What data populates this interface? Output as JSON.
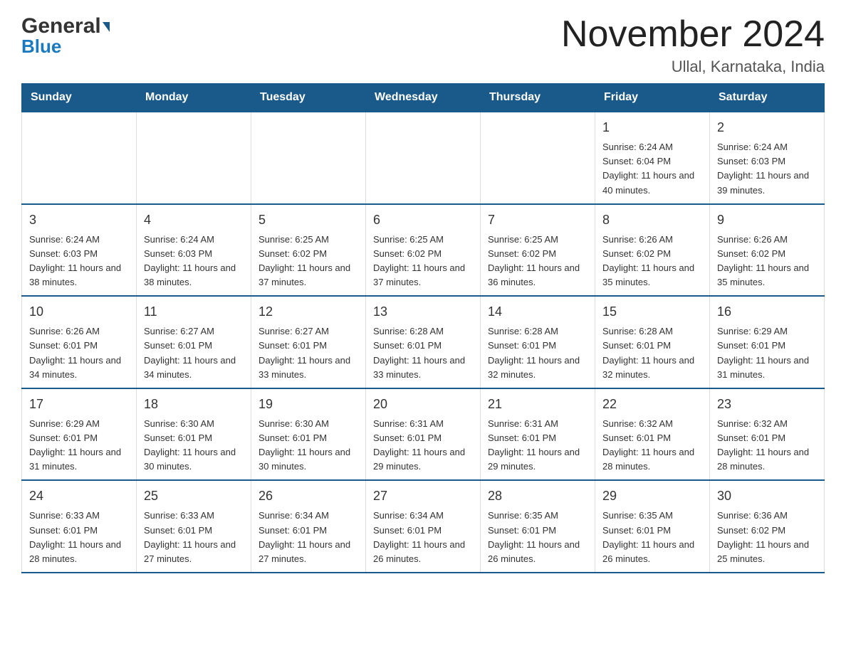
{
  "header": {
    "logo_main": "General",
    "logo_blue": "Blue",
    "month_title": "November 2024",
    "location": "Ullal, Karnataka, India"
  },
  "days_of_week": [
    "Sunday",
    "Monday",
    "Tuesday",
    "Wednesday",
    "Thursday",
    "Friday",
    "Saturday"
  ],
  "weeks": [
    [
      {
        "day": "",
        "info": ""
      },
      {
        "day": "",
        "info": ""
      },
      {
        "day": "",
        "info": ""
      },
      {
        "day": "",
        "info": ""
      },
      {
        "day": "",
        "info": ""
      },
      {
        "day": "1",
        "info": "Sunrise: 6:24 AM\nSunset: 6:04 PM\nDaylight: 11 hours and 40 minutes."
      },
      {
        "day": "2",
        "info": "Sunrise: 6:24 AM\nSunset: 6:03 PM\nDaylight: 11 hours and 39 minutes."
      }
    ],
    [
      {
        "day": "3",
        "info": "Sunrise: 6:24 AM\nSunset: 6:03 PM\nDaylight: 11 hours and 38 minutes."
      },
      {
        "day": "4",
        "info": "Sunrise: 6:24 AM\nSunset: 6:03 PM\nDaylight: 11 hours and 38 minutes."
      },
      {
        "day": "5",
        "info": "Sunrise: 6:25 AM\nSunset: 6:02 PM\nDaylight: 11 hours and 37 minutes."
      },
      {
        "day": "6",
        "info": "Sunrise: 6:25 AM\nSunset: 6:02 PM\nDaylight: 11 hours and 37 minutes."
      },
      {
        "day": "7",
        "info": "Sunrise: 6:25 AM\nSunset: 6:02 PM\nDaylight: 11 hours and 36 minutes."
      },
      {
        "day": "8",
        "info": "Sunrise: 6:26 AM\nSunset: 6:02 PM\nDaylight: 11 hours and 35 minutes."
      },
      {
        "day": "9",
        "info": "Sunrise: 6:26 AM\nSunset: 6:02 PM\nDaylight: 11 hours and 35 minutes."
      }
    ],
    [
      {
        "day": "10",
        "info": "Sunrise: 6:26 AM\nSunset: 6:01 PM\nDaylight: 11 hours and 34 minutes."
      },
      {
        "day": "11",
        "info": "Sunrise: 6:27 AM\nSunset: 6:01 PM\nDaylight: 11 hours and 34 minutes."
      },
      {
        "day": "12",
        "info": "Sunrise: 6:27 AM\nSunset: 6:01 PM\nDaylight: 11 hours and 33 minutes."
      },
      {
        "day": "13",
        "info": "Sunrise: 6:28 AM\nSunset: 6:01 PM\nDaylight: 11 hours and 33 minutes."
      },
      {
        "day": "14",
        "info": "Sunrise: 6:28 AM\nSunset: 6:01 PM\nDaylight: 11 hours and 32 minutes."
      },
      {
        "day": "15",
        "info": "Sunrise: 6:28 AM\nSunset: 6:01 PM\nDaylight: 11 hours and 32 minutes."
      },
      {
        "day": "16",
        "info": "Sunrise: 6:29 AM\nSunset: 6:01 PM\nDaylight: 11 hours and 31 minutes."
      }
    ],
    [
      {
        "day": "17",
        "info": "Sunrise: 6:29 AM\nSunset: 6:01 PM\nDaylight: 11 hours and 31 minutes."
      },
      {
        "day": "18",
        "info": "Sunrise: 6:30 AM\nSunset: 6:01 PM\nDaylight: 11 hours and 30 minutes."
      },
      {
        "day": "19",
        "info": "Sunrise: 6:30 AM\nSunset: 6:01 PM\nDaylight: 11 hours and 30 minutes."
      },
      {
        "day": "20",
        "info": "Sunrise: 6:31 AM\nSunset: 6:01 PM\nDaylight: 11 hours and 29 minutes."
      },
      {
        "day": "21",
        "info": "Sunrise: 6:31 AM\nSunset: 6:01 PM\nDaylight: 11 hours and 29 minutes."
      },
      {
        "day": "22",
        "info": "Sunrise: 6:32 AM\nSunset: 6:01 PM\nDaylight: 11 hours and 28 minutes."
      },
      {
        "day": "23",
        "info": "Sunrise: 6:32 AM\nSunset: 6:01 PM\nDaylight: 11 hours and 28 minutes."
      }
    ],
    [
      {
        "day": "24",
        "info": "Sunrise: 6:33 AM\nSunset: 6:01 PM\nDaylight: 11 hours and 28 minutes."
      },
      {
        "day": "25",
        "info": "Sunrise: 6:33 AM\nSunset: 6:01 PM\nDaylight: 11 hours and 27 minutes."
      },
      {
        "day": "26",
        "info": "Sunrise: 6:34 AM\nSunset: 6:01 PM\nDaylight: 11 hours and 27 minutes."
      },
      {
        "day": "27",
        "info": "Sunrise: 6:34 AM\nSunset: 6:01 PM\nDaylight: 11 hours and 26 minutes."
      },
      {
        "day": "28",
        "info": "Sunrise: 6:35 AM\nSunset: 6:01 PM\nDaylight: 11 hours and 26 minutes."
      },
      {
        "day": "29",
        "info": "Sunrise: 6:35 AM\nSunset: 6:01 PM\nDaylight: 11 hours and 26 minutes."
      },
      {
        "day": "30",
        "info": "Sunrise: 6:36 AM\nSunset: 6:02 PM\nDaylight: 11 hours and 25 minutes."
      }
    ]
  ]
}
